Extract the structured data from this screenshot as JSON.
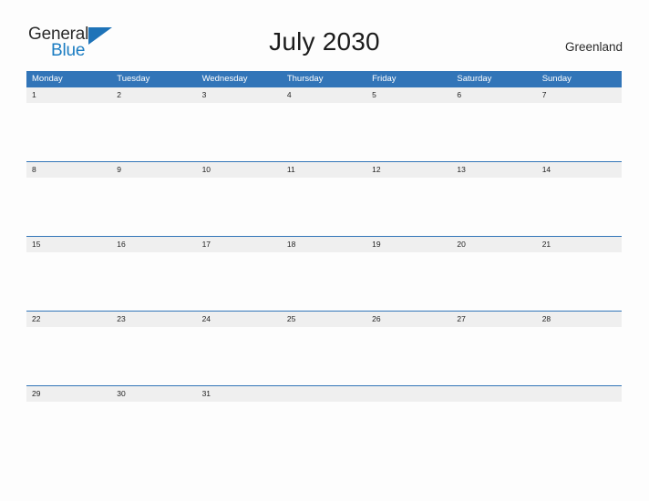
{
  "brand": {
    "name_part1": "General",
    "name_part2": "Blue",
    "flag_icon": "triangle-flag-icon",
    "color_dark": "#2b2b2b",
    "color_blue": "#1a7cc2"
  },
  "header": {
    "title": "July 2030",
    "region": "Greenland"
  },
  "theme": {
    "header_blue": "#3275b8",
    "band_gray": "#efefef",
    "page_bg": "#fdfdfd",
    "text_dark": "#1f1f1f"
  },
  "calendar": {
    "month": "July",
    "year": "2030",
    "first_day_of_week": "Monday",
    "weekdays": [
      "Monday",
      "Tuesday",
      "Wednesday",
      "Thursday",
      "Friday",
      "Saturday",
      "Sunday"
    ],
    "weeks": [
      [
        "1",
        "2",
        "3",
        "4",
        "5",
        "6",
        "7"
      ],
      [
        "8",
        "9",
        "10",
        "11",
        "12",
        "13",
        "14"
      ],
      [
        "15",
        "16",
        "17",
        "18",
        "19",
        "20",
        "21"
      ],
      [
        "22",
        "23",
        "24",
        "25",
        "26",
        "27",
        "28"
      ],
      [
        "29",
        "30",
        "31",
        "",
        "",
        "",
        ""
      ]
    ]
  }
}
